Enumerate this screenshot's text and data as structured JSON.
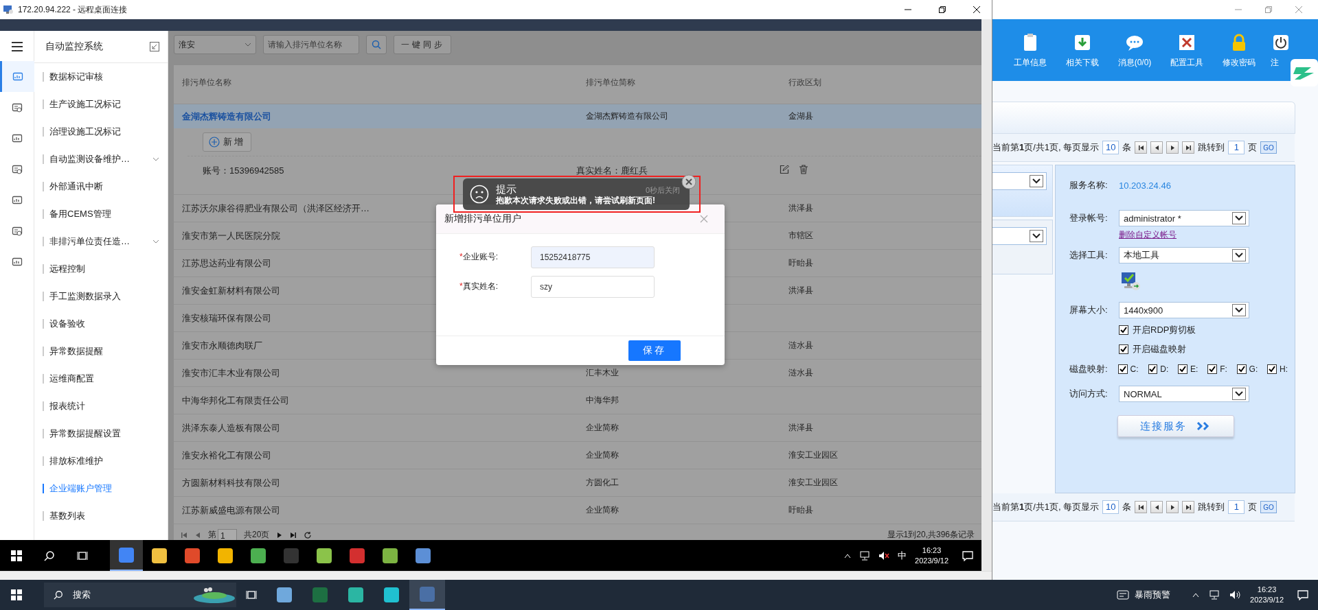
{
  "rdp_window": {
    "title": "172.20.94.222 - 远程桌面连接"
  },
  "remote_app": {
    "rail": [
      {
        "selected": true
      },
      {
        "selected": false
      },
      {
        "selected": false
      },
      {
        "selected": false
      },
      {
        "selected": false
      },
      {
        "selected": false
      },
      {
        "selected": false
      }
    ],
    "menu_title": "自动监控系统",
    "menu": [
      {
        "label": "数据标记审核",
        "selected": false,
        "expandable": false
      },
      {
        "label": "生产设施工况标记",
        "selected": false,
        "expandable": false
      },
      {
        "label": "治理设施工况标记",
        "selected": false,
        "expandable": false
      },
      {
        "label": "自动监测设备维护…",
        "selected": false,
        "expandable": true
      },
      {
        "label": "外部通讯中断",
        "selected": false,
        "expandable": false
      },
      {
        "label": "备用CEMS管理",
        "selected": false,
        "expandable": false
      },
      {
        "label": "非排污单位责任造…",
        "selected": false,
        "expandable": true
      },
      {
        "label": "远程控制",
        "selected": false,
        "expandable": false
      },
      {
        "label": "手工监测数据录入",
        "selected": false,
        "expandable": false
      },
      {
        "label": "设备验收",
        "selected": false,
        "expandable": false
      },
      {
        "label": "异常数据提醒",
        "selected": false,
        "expandable": false
      },
      {
        "label": "运维商配置",
        "selected": false,
        "expandable": false
      },
      {
        "label": "报表统计",
        "selected": false,
        "expandable": false
      },
      {
        "label": "异常数据提醒设置",
        "selected": false,
        "expandable": false
      },
      {
        "label": "排放标准维护",
        "selected": false,
        "expandable": false
      },
      {
        "label": "企业端账户管理",
        "selected": true,
        "expandable": false
      },
      {
        "label": "基数列表",
        "selected": false,
        "expandable": false
      }
    ],
    "toolbar": {
      "region": "淮安",
      "search_placeholder": "请输入排污单位名称",
      "sync_button": "一键同步"
    },
    "table": {
      "columns": [
        "排污单位名称",
        "排污单位简称",
        "行政区划"
      ],
      "expanded": {
        "add_button": "新增",
        "account": "账号：15396942585",
        "real_name": "真实姓名：鹿红兵"
      },
      "rows": [
        {
          "name": "金湖杰辉铸造有限公司",
          "short_name": "金湖杰辉铸造有限公司",
          "district": "金湖县",
          "selected": true
        },
        {
          "name": "江苏沃尔康谷得肥业有限公司（洪泽区经济开…",
          "district": "洪泽县",
          "selected": false
        },
        {
          "name": "淮安市第一人民医院分院",
          "district": "市辖区",
          "selected": false
        },
        {
          "name": "江苏思达药业有限公司",
          "district": "盱眙县",
          "selected": false
        },
        {
          "name": "淮安金虹新材料有限公司",
          "district": "洪泽县",
          "selected": false
        },
        {
          "name": "淮安核瑞环保有限公司",
          "selected": false
        },
        {
          "name": "淮安市永顺德肉联厂",
          "district": "涟水县",
          "selected": false
        },
        {
          "name": "淮安市汇丰木业有限公司",
          "short_name": "汇丰木业",
          "district": "涟水县",
          "selected": false
        },
        {
          "name": "中海华邦化工有限责任公司",
          "short_name": "中海华邦",
          "selected": false
        },
        {
          "name": "洪泽东泰人造板有限公司",
          "short_name": "企业简称",
          "district": "洪泽县",
          "selected": false
        },
        {
          "name": "淮安永裕化工有限公司",
          "short_name": "企业简称",
          "district": "淮安工业园区",
          "selected": false
        },
        {
          "name": "方圆新材料科技有限公司",
          "short_name": "方圆化工",
          "district": "淮安工业园区",
          "selected": false
        },
        {
          "name": "江苏新威盛电源有限公司",
          "short_name": "企业简称",
          "district": "盱眙县",
          "selected": false
        }
      ]
    },
    "pager": {
      "page_prefix": "第",
      "page": "1",
      "total": "共20页",
      "summary": "显示1到20,共396条记录"
    }
  },
  "dialog": {
    "title": "新增排污单位用户",
    "fields": [
      {
        "required_mark": "*",
        "label": "企业账号:",
        "value": "15252418775",
        "focused": true
      },
      {
        "required_mark": "*",
        "label": "真实姓名:",
        "value": "szy",
        "focused": false
      }
    ],
    "save_button": "保存"
  },
  "toast": {
    "title": "提示",
    "message": "抱歉本次请求失败或出错，请尝试刷新页面!",
    "countdown": "0秒后关闭"
  },
  "remote_taskbar": {
    "apps": [
      {
        "selected": true
      },
      {
        "selected": false
      },
      {
        "selected": false
      },
      {
        "selected": false
      },
      {
        "selected": false
      },
      {
        "selected": false
      },
      {
        "selected": false
      },
      {
        "selected": false
      },
      {
        "selected": false
      },
      {
        "selected": false
      }
    ],
    "ime": "中",
    "time": "16:23",
    "date": "2023/9/12"
  },
  "local_app": {
    "toolbar": [
      "工单信息",
      "相关下载",
      "消息(0/0)",
      "配置工具",
      "修改密码",
      "注"
    ],
    "pagers": [
      {
        "summary": "当前第**1**页/共1页, 每页显示",
        "page_size": "10",
        "unit": "条",
        "jump_label": "跳转到",
        "jump_page": "1",
        "page_unit": "页",
        "go": "GO"
      },
      {
        "summary": "当前第**1**页/共1页, 每页显示",
        "page_size": "10",
        "unit": "条",
        "jump_label": "跳转到",
        "jump_page": "1",
        "page_unit": "页",
        "go": "GO"
      }
    ],
    "service_panel": {
      "service_label": "服务名称:",
      "service_value": "10.203.24.46",
      "fields": [
        {
          "kind": "select",
          "label": "登录帐号:",
          "value": "administrator *"
        },
        {
          "kind": "link",
          "text": "删除自定义帐号"
        },
        {
          "kind": "select",
          "label": "选择工具:",
          "value": "本地工具"
        },
        {
          "kind": "tool_icon"
        },
        {
          "kind": "select",
          "label": "屏幕大小:",
          "value": "1440x900"
        },
        {
          "kind": "checkbox",
          "text": "开启RDP剪切板",
          "checked": true
        },
        {
          "kind": "checkbox",
          "text": "开启磁盘映射",
          "checked": true
        },
        {
          "kind": "drives",
          "label": "磁盘映射:",
          "drives": [
            {
              "text": "C:",
              "checked": true
            },
            {
              "text": "D:",
              "checked": true
            },
            {
              "text": "E:",
              "checked": true
            },
            {
              "text": "F:",
              "checked": true
            },
            {
              "text": "G:",
              "checked": true
            },
            {
              "text": "H:",
              "checked": true
            }
          ]
        },
        {
          "kind": "select",
          "label": "访问方式:",
          "value": "NORMAL"
        },
        {
          "kind": "button",
          "text": "连接服务"
        }
      ]
    }
  },
  "taskbar": {
    "search": "搜索",
    "apps": [
      {
        "selected": false
      },
      {
        "selected": false
      },
      {
        "selected": false
      },
      {
        "selected": false
      },
      {
        "selected": true
      }
    ],
    "weather": "暴雨预警",
    "time": "16:23",
    "date": "2023/9/12"
  }
}
